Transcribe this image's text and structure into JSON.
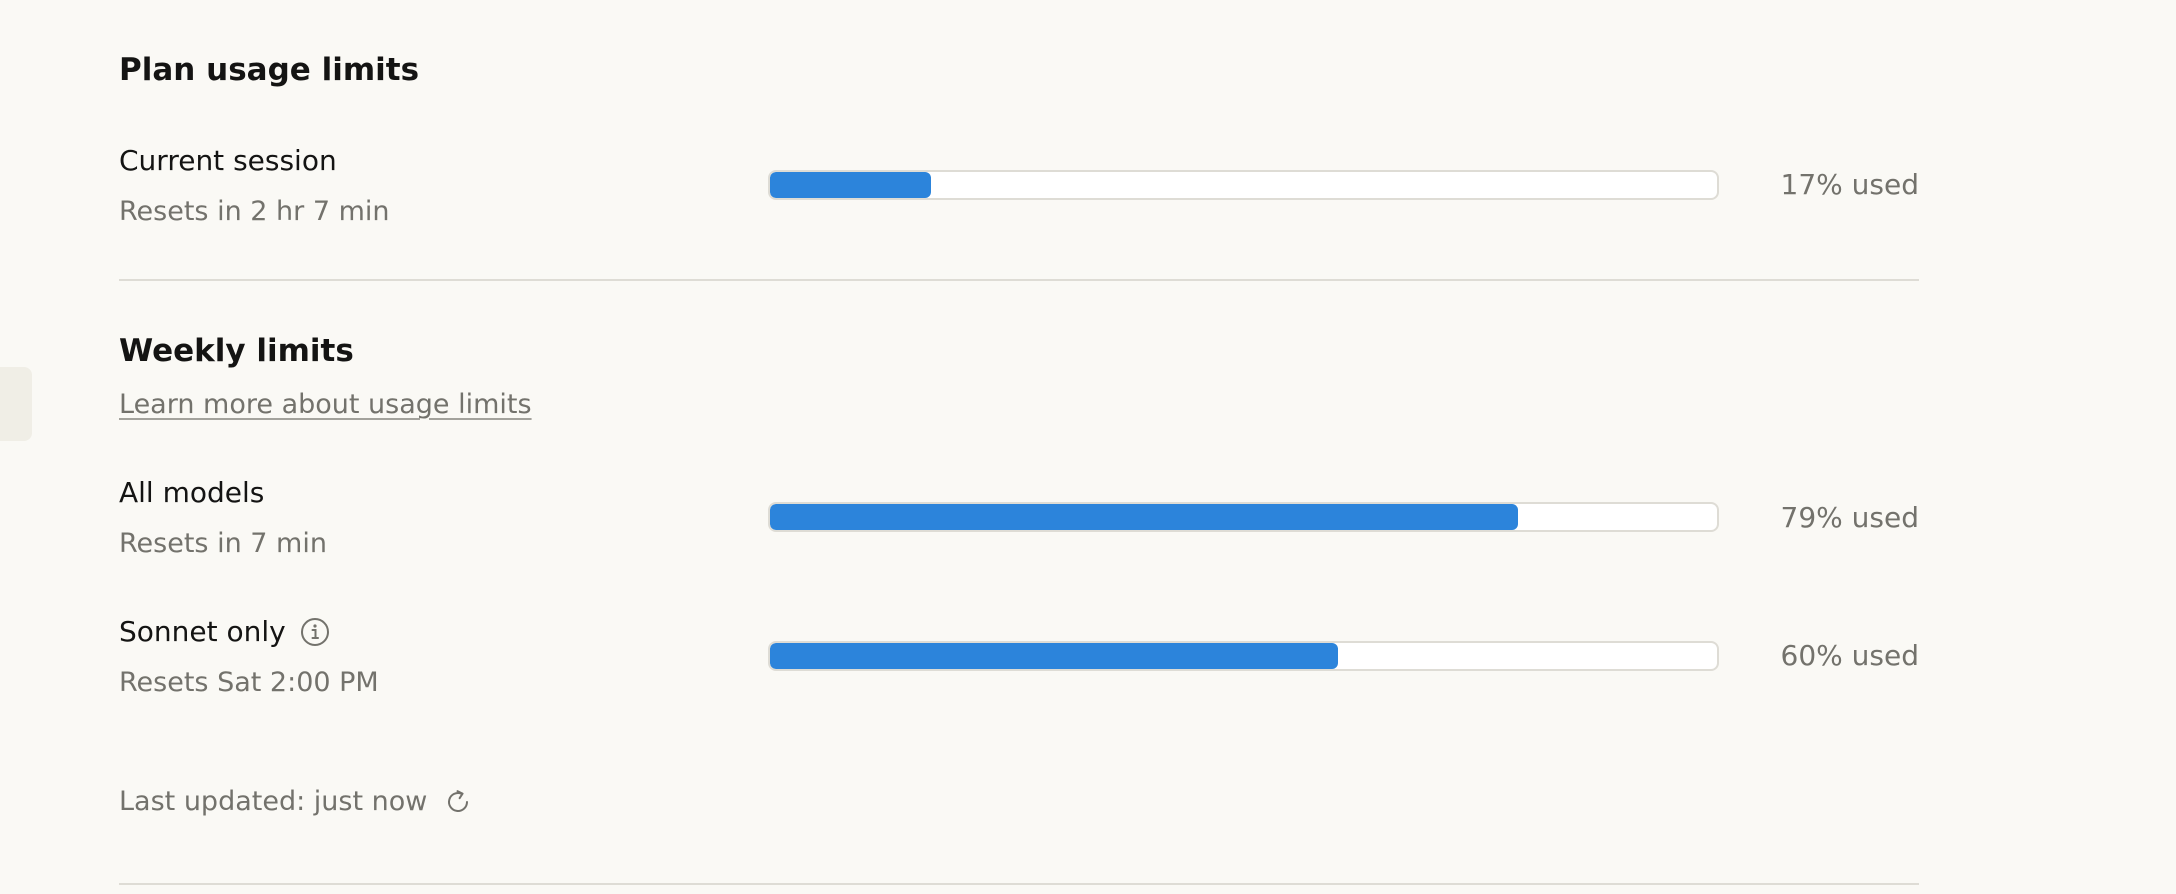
{
  "plan": {
    "title": "Plan usage limits",
    "current_session": {
      "label": "Current session",
      "reset": "Resets in 2 hr 7 min",
      "percent": 17,
      "used_text": "17% used"
    }
  },
  "weekly": {
    "title": "Weekly limits",
    "learn_more": "Learn more about usage limits",
    "all_models": {
      "label": "All models",
      "reset": "Resets in 7 min",
      "percent": 79,
      "used_text": "79% used"
    },
    "sonnet_only": {
      "label": "Sonnet only",
      "reset": "Resets Sat 2:00 PM",
      "percent": 60,
      "used_text": "60% used",
      "icon": "info-icon"
    }
  },
  "footer": {
    "last_updated": "Last updated: just now",
    "icon": "refresh-icon"
  },
  "colors": {
    "accent": "#2c84db",
    "background": "#faf9f5"
  }
}
